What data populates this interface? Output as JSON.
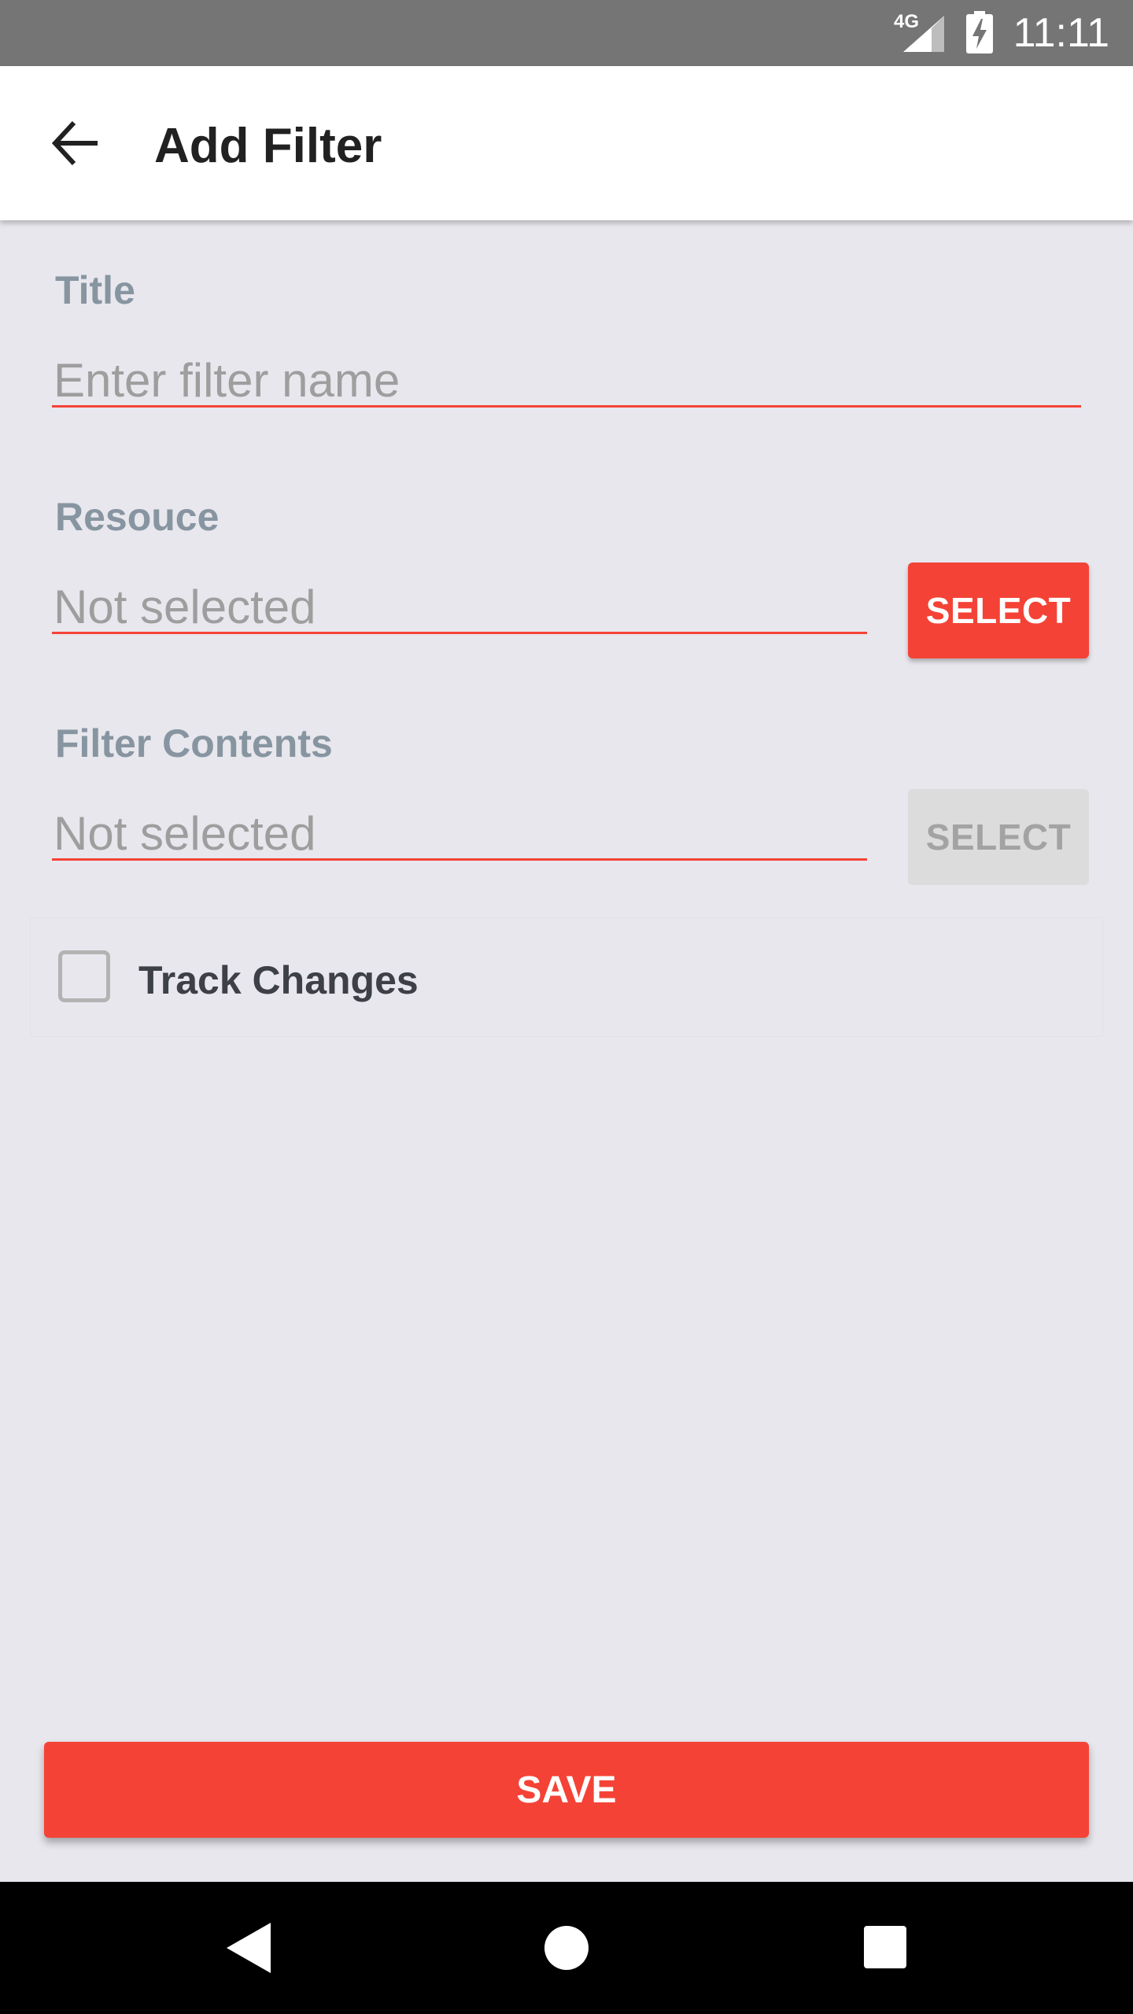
{
  "status_bar": {
    "network": "4G",
    "time": "11:11"
  },
  "app_bar": {
    "title": "Add Filter",
    "back_icon": "arrow-back-icon"
  },
  "form": {
    "title": {
      "label": "Title",
      "placeholder": "Enter filter name"
    },
    "resource": {
      "label": "Resouce",
      "value": "Not selected",
      "button_label": "SELECT"
    },
    "filter_contents": {
      "label": "Filter Contents",
      "value": "Not selected",
      "button_label": "SELECT"
    },
    "track_changes": {
      "label": "Track Changes",
      "checked": false
    }
  },
  "save_button": {
    "label": "SAVE"
  },
  "colors": {
    "accent": "#f44336",
    "background": "#e8e7ed",
    "label": "#8795a1",
    "status_bar": "#757575"
  },
  "nav_bar": {
    "icons": [
      "nav-back-icon",
      "nav-home-icon",
      "nav-recent-apps-icon"
    ]
  }
}
